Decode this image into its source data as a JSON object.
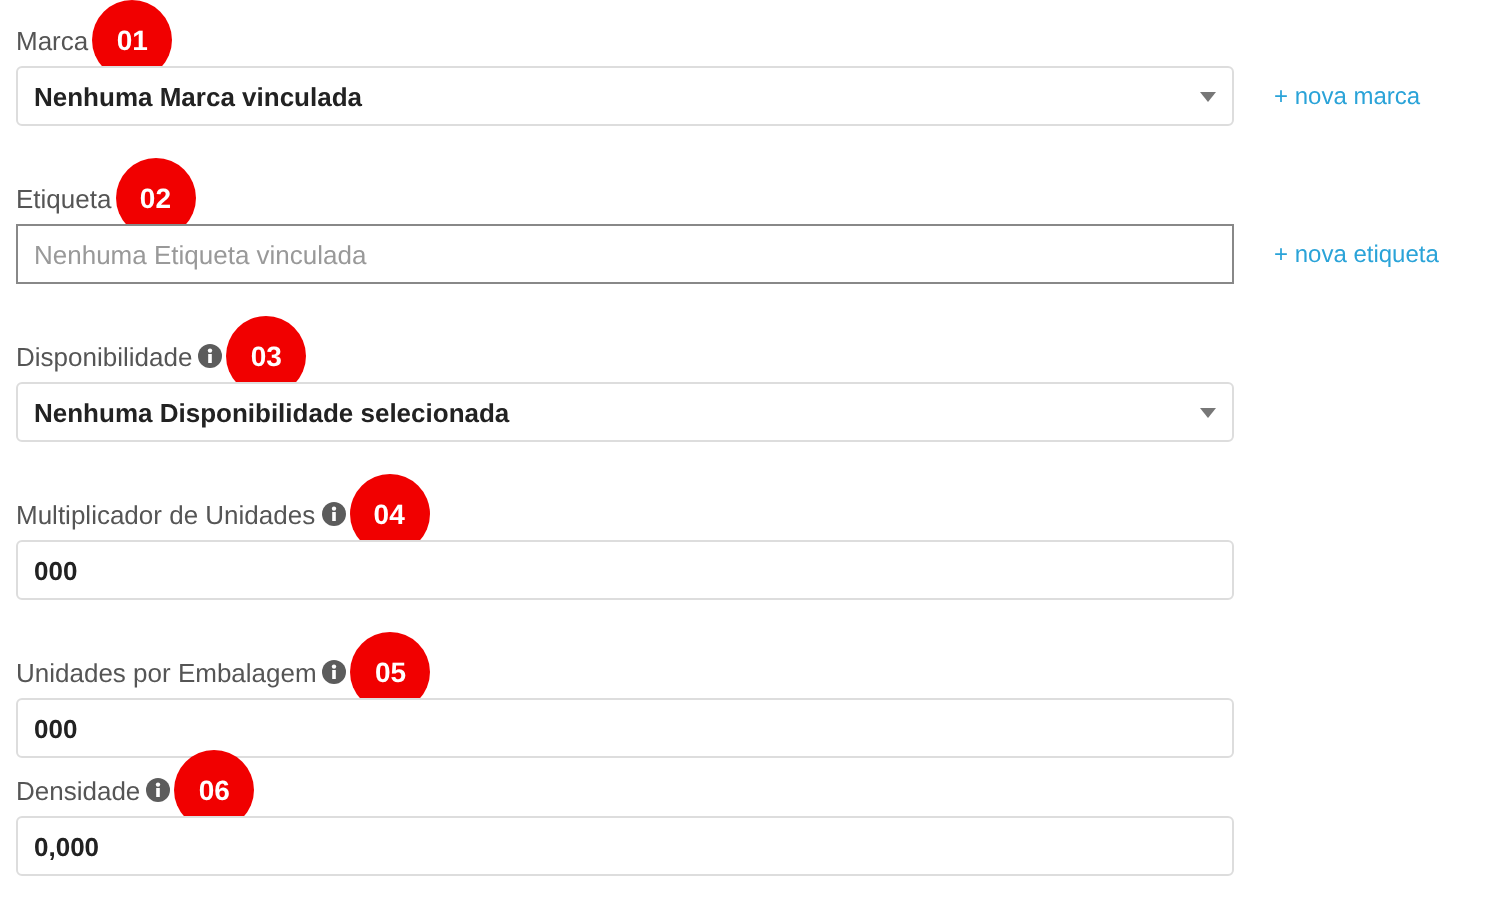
{
  "fields": [
    {
      "kind": "select",
      "label": "Marca",
      "info": false,
      "badge": "01",
      "value": "Nenhuma Marca vinculada",
      "link": "+ nova marca"
    },
    {
      "kind": "input",
      "label": "Etiqueta",
      "info": false,
      "badge": "02",
      "placeholder": "Nenhuma Etiqueta vinculada",
      "link": "+ nova etiqueta"
    },
    {
      "kind": "select",
      "label": "Disponibilidade",
      "info": true,
      "badge": "03",
      "value": "Nenhuma Disponibilidade selecionada"
    },
    {
      "kind": "input",
      "label": "Multiplicador de Unidades",
      "info": true,
      "badge": "04",
      "value": "000"
    },
    {
      "kind": "input",
      "label": "Unidades por Embalagem",
      "info": true,
      "badge": "05",
      "value": "000"
    },
    {
      "kind": "input",
      "label": "Densidade",
      "info": true,
      "badge": "06",
      "value": "0,000"
    }
  ]
}
